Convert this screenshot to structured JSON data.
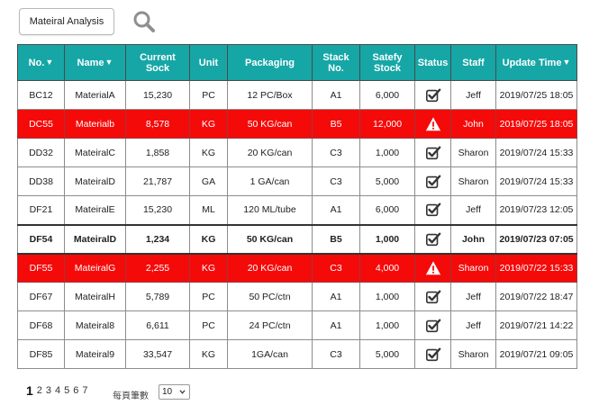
{
  "toolbar": {
    "analysis_button": "Mateiral Analysis",
    "search_icon": "search-icon"
  },
  "colors": {
    "header_bg": "#16a6a6",
    "alert_row_bg": "#f50a0a",
    "text": "#222222"
  },
  "table": {
    "sort_indicator": "▼",
    "headers": [
      {
        "label": "No.",
        "sortable": true
      },
      {
        "label": "Name",
        "sortable": true
      },
      {
        "label": "Current Sock",
        "sortable": false
      },
      {
        "label": "Unit",
        "sortable": false
      },
      {
        "label": "Packaging",
        "sortable": false
      },
      {
        "label": "Stack No.",
        "sortable": false
      },
      {
        "label": "Satefy Stock",
        "sortable": false
      },
      {
        "label": "Status",
        "sortable": false
      },
      {
        "label": "Staff",
        "sortable": false
      },
      {
        "label": "Update Time",
        "sortable": true
      }
    ],
    "rows": [
      {
        "no": "BC12",
        "name": "MaterialA",
        "stock": "15,230",
        "unit": "PC",
        "packaging": "12 PC/Box",
        "stack": "A1",
        "safety": "6,000",
        "status": "ok",
        "staff": "Jeff",
        "time": "2019/07/25 18:05"
      },
      {
        "no": "DC55",
        "name": "Materialb",
        "stock": "8,578",
        "unit": "KG",
        "packaging": "50 KG/can",
        "stack": "B5",
        "safety": "12,000",
        "status": "warning",
        "staff": "John",
        "time": "2019/07/25 18:05"
      },
      {
        "no": "DD32",
        "name": "MateiralC",
        "stock": "1,858",
        "unit": "KG",
        "packaging": "20 KG/can",
        "stack": "C3",
        "safety": "1,000",
        "status": "ok",
        "staff": "Sharon",
        "time": "2019/07/24 15:33"
      },
      {
        "no": "DD38",
        "name": "MateiralD",
        "stock": "21,787",
        "unit": "GA",
        "packaging": "1 GA/can",
        "stack": "C3",
        "safety": "5,000",
        "status": "ok",
        "staff": "Sharon",
        "time": "2019/07/24 15:33"
      },
      {
        "no": "DF21",
        "name": "MateiralE",
        "stock": "15,230",
        "unit": "ML",
        "packaging": "120 ML/tube",
        "stack": "A1",
        "safety": "6,000",
        "status": "ok",
        "staff": "Jeff",
        "time": "2019/07/23 12:05"
      },
      {
        "no": "DF54",
        "name": "MateiralD",
        "stock": "1,234",
        "unit": "KG",
        "packaging": "50 KG/can",
        "stack": "B5",
        "safety": "1,000",
        "status": "ok",
        "staff": "John",
        "time": "2019/07/23 07:05"
      },
      {
        "no": "DF55",
        "name": "MateiralG",
        "stock": "2,255",
        "unit": "KG",
        "packaging": "20 KG/can",
        "stack": "C3",
        "safety": "4,000",
        "status": "warning",
        "staff": "Sharon",
        "time": "2019/07/22 15:33"
      },
      {
        "no": "DF67",
        "name": "MateiralH",
        "stock": "5,789",
        "unit": "PC",
        "packaging": "50 PC/ctn",
        "stack": "A1",
        "safety": "1,000",
        "status": "ok",
        "staff": "Jeff",
        "time": "2019/07/22 18:47"
      },
      {
        "no": "DF68",
        "name": "Mateiral8",
        "stock": "6,611",
        "unit": "PC",
        "packaging": "24 PC/ctn",
        "stack": "A1",
        "safety": "1,000",
        "status": "ok",
        "staff": "Jeff",
        "time": "2019/07/21 14:22"
      },
      {
        "no": "DF85",
        "name": "Mateiral9",
        "stock": "33,547",
        "unit": "KG",
        "packaging": "1GA/can",
        "stack": "C3",
        "safety": "5,000",
        "status": "ok",
        "staff": "Sharon",
        "time": "2019/07/21 09:05"
      }
    ]
  },
  "pagination": {
    "pages": [
      "1",
      "2",
      "3",
      "4",
      "5",
      "6",
      "7"
    ],
    "current_page": "1",
    "per_page_label": "每頁筆數",
    "per_page_value": "10"
  }
}
